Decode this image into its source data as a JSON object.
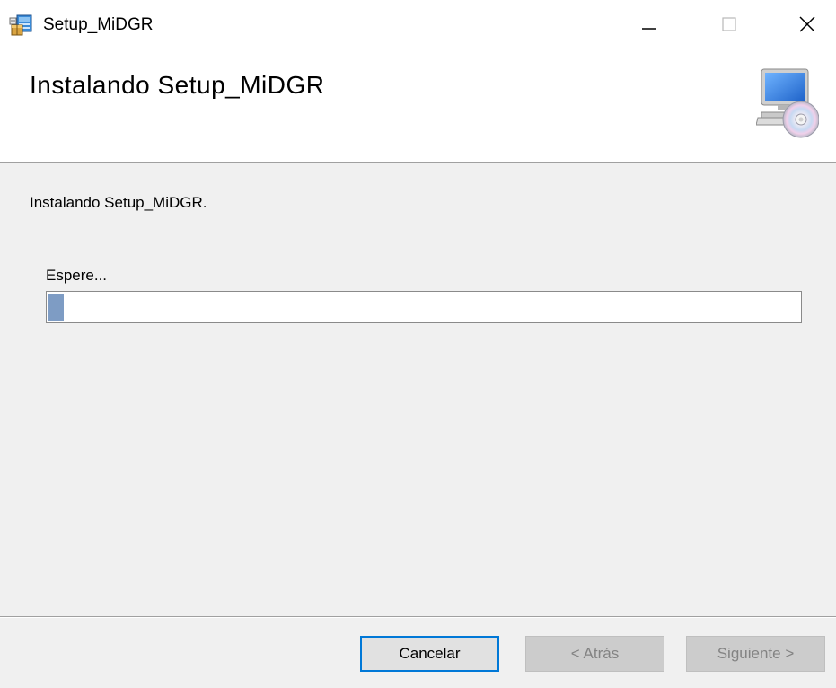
{
  "window": {
    "title": "Setup_MiDGR",
    "app_icon": "installer-package-icon",
    "controls": {
      "minimize_icon": "minimize-icon",
      "maximize_icon": "maximize-icon",
      "close_icon": "close-icon"
    }
  },
  "header": {
    "title": "Instalando Setup_MiDGR",
    "icon": "computer-cd-icon"
  },
  "body": {
    "status": "Instalando Setup_MiDGR.",
    "wait_label": "Espere...",
    "progress": {
      "fraction": 0.02
    }
  },
  "buttons": {
    "cancel_label": "Cancelar",
    "back_label": "< Atrás",
    "next_label": "Siguiente >"
  },
  "colors": {
    "accent": "#0078d7",
    "progress_fill": "#7e9cc4",
    "disabled_text": "#838383"
  }
}
